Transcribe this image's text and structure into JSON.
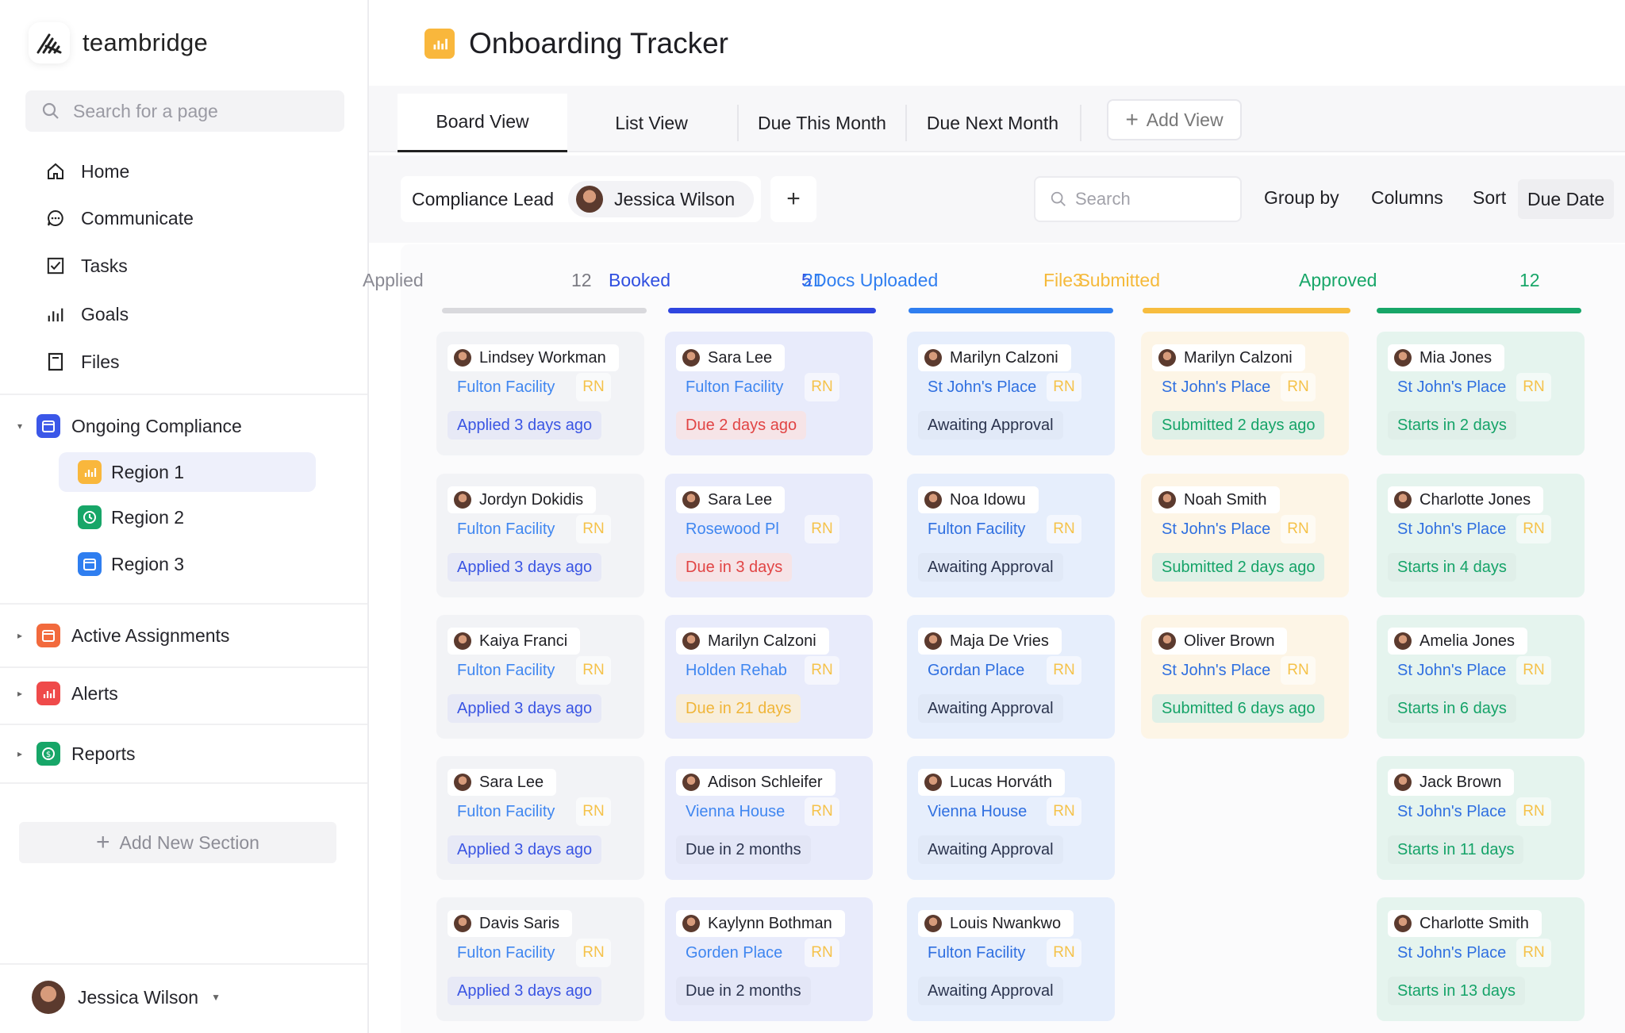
{
  "app": {
    "name": "teambridge"
  },
  "sidebar": {
    "search_placeholder": "Search for a page",
    "nav": [
      {
        "label": "Home",
        "icon": "home-icon"
      },
      {
        "label": "Communicate",
        "icon": "chat-icon"
      },
      {
        "label": "Tasks",
        "icon": "checkbox-icon"
      },
      {
        "label": "Goals",
        "icon": "bar-chart-icon"
      },
      {
        "label": "Files",
        "icon": "file-icon"
      }
    ],
    "sections": [
      {
        "label": "Ongoing Compliance",
        "icon": "calendar-icon",
        "color": "#3b57e8",
        "expanded": true,
        "children": [
          {
            "label": "Region 1",
            "icon": "chart-icon",
            "color": "#f9b73c",
            "active": true
          },
          {
            "label": "Region 2",
            "icon": "clock-icon",
            "color": "#17a668"
          },
          {
            "label": "Region 3",
            "icon": "calendar-icon",
            "color": "#2f7ef0"
          }
        ]
      },
      {
        "label": "Active Assignments",
        "icon": "calendar-icon",
        "color": "#f26a3d"
      },
      {
        "label": "Alerts",
        "icon": "chart-icon",
        "color": "#ef4a4a"
      },
      {
        "label": "Reports",
        "icon": "dollar-icon",
        "color": "#17a668"
      }
    ],
    "add_section": "Add New Section",
    "user": "Jessica Wilson"
  },
  "page": {
    "title": "Onboarding Tracker"
  },
  "tabs": [
    "Board View",
    "List View",
    "Due This Month",
    "Due Next Month"
  ],
  "add_view": "Add View",
  "filter": {
    "label": "Compliance Lead",
    "value": "Jessica Wilson"
  },
  "toolbar": {
    "search_placeholder": "Search",
    "group_by": "Group by",
    "columns": "Columns",
    "sort": "Sort",
    "sort_value": "Due Date"
  },
  "columns": [
    {
      "title": "Applied",
      "count": "12",
      "color": "#8a8a93",
      "bar": "#d9d9dd",
      "card_bg": "#f2f3f6",
      "fac_color": "#3f86f0",
      "rn_color": "#f5c24a",
      "stat_color": "#3b57e8",
      "stat_bg": "#eceefb",
      "cards": [
        {
          "name": "Lindsey Workman",
          "facility": "Fulton Facility",
          "rn": "RN",
          "status": "Applied 3 days ago"
        },
        {
          "name": "Jordyn Dokidis",
          "facility": "Fulton Facility",
          "rn": "RN",
          "status": "Applied 3 days ago"
        },
        {
          "name": "Kaiya Franci",
          "facility": "Fulton Facility",
          "rn": "RN",
          "status": "Applied 3 days ago"
        },
        {
          "name": "Sara Lee",
          "facility": "Fulton Facility",
          "rn": "RN",
          "status": "Applied 3 days ago"
        },
        {
          "name": "Davis Saris",
          "facility": "Fulton Facility",
          "rn": "RN",
          "status": "Applied 3 days ago"
        }
      ]
    },
    {
      "title": "Booked",
      "count": "5",
      "color": "#2f4fe0",
      "bar": "#2f46e0",
      "card_bg": "#e8ebfb",
      "fac_color": "#3f86f0",
      "rn_color": "#f5c24a",
      "stat_color": "#e64545",
      "stat_bg": "#fbe9ec",
      "cards": [
        {
          "name": "Sara Lee",
          "facility": "Fulton Facility",
          "rn": "RN",
          "status": "Due 2 days ago"
        },
        {
          "name": "Sara Lee",
          "facility": "Rosewood Pl",
          "rn": "RN",
          "status": "Due in 3 days"
        },
        {
          "name": "Marilyn Calzoni",
          "facility": "Holden Rehab",
          "rn": "RN",
          "status": "Due in 21 days",
          "stat_color": "#f5b93a",
          "stat_bg": "#fdf3df"
        },
        {
          "name": "Adison Schleifer",
          "facility": "Vienna House",
          "rn": "RN",
          "status": "Due in 2 months",
          "stat_color": "#2c3550",
          "stat_bg": "#e8ebfb"
        },
        {
          "name": "Kaylynn Bothman",
          "facility": "Gorden Place",
          "rn": "RN",
          "status": "Due in 2 months",
          "stat_color": "#2c3550",
          "stat_bg": "#e8ebfb"
        }
      ]
    },
    {
      "title": "Docs Uploaded",
      "count": "21",
      "color": "#2f7ef0",
      "bar": "#2f7ef0",
      "card_bg": "#e6eefc",
      "fac_color": "#2f6fe0",
      "rn_color": "#f5c24a",
      "stat_color": "#2c3550",
      "stat_bg": "#e6eefc",
      "cards": [
        {
          "name": "Marilyn Calzoni",
          "facility": "St John's Place",
          "rn": "RN",
          "status": "Awaiting Approval"
        },
        {
          "name": "Noa Idowu",
          "facility": "Fulton Facility",
          "rn": "RN",
          "status": "Awaiting Approval"
        },
        {
          "name": "Maja De Vries",
          "facility": "Gordan Place",
          "rn": "RN",
          "status": "Awaiting Approval"
        },
        {
          "name": "Lucas Horváth",
          "facility": "Vienna House",
          "rn": "RN",
          "status": "Awaiting Approval"
        },
        {
          "name": "Louis Nwankwo",
          "facility": "Fulton Facility",
          "rn": "RN",
          "status": "Awaiting Approval"
        }
      ]
    },
    {
      "title": "File Submitted",
      "count": "3",
      "color": "#f5b93a",
      "bar": "#f7bd3f",
      "card_bg": "#fdf5e6",
      "fac_color": "#2f6fe0",
      "rn_color": "#f5c24a",
      "stat_color": "#15a66a",
      "stat_bg": "#e4f5ec",
      "cards": [
        {
          "name": "Marilyn Calzoni",
          "facility": "St John's Place",
          "rn": "RN",
          "status": "Submitted 2 days ago"
        },
        {
          "name": "Noah Smith",
          "facility": "St John's Place",
          "rn": "RN",
          "status": "Submitted 2 days ago"
        },
        {
          "name": "Oliver Brown",
          "facility": "St John's Place",
          "rn": "RN",
          "status": "Submitted 6 days ago"
        }
      ]
    },
    {
      "title": "Approved",
      "count": "12",
      "color": "#17a668",
      "bar": "#17a668",
      "card_bg": "#e5f4ee",
      "fac_color": "#2f6fe0",
      "rn_color": "#f5c24a",
      "stat_color": "#15a66a",
      "stat_bg": "#e5f4ee",
      "cards": [
        {
          "name": "Mia Jones",
          "facility": "St John's Place",
          "rn": "RN",
          "status": "Starts in 2 days"
        },
        {
          "name": "Charlotte Jones",
          "facility": "St John's Place",
          "rn": "RN",
          "status": "Starts in 4 days"
        },
        {
          "name": "Amelia Jones",
          "facility": "St John's Place",
          "rn": "RN",
          "status": "Starts in 6 days"
        },
        {
          "name": "Jack Brown",
          "facility": "St John's Place",
          "rn": "RN",
          "status": "Starts in 11 days"
        },
        {
          "name": "Charlotte Smith",
          "facility": "St John's Place",
          "rn": "RN",
          "status": "Starts in 13 days"
        }
      ]
    }
  ]
}
